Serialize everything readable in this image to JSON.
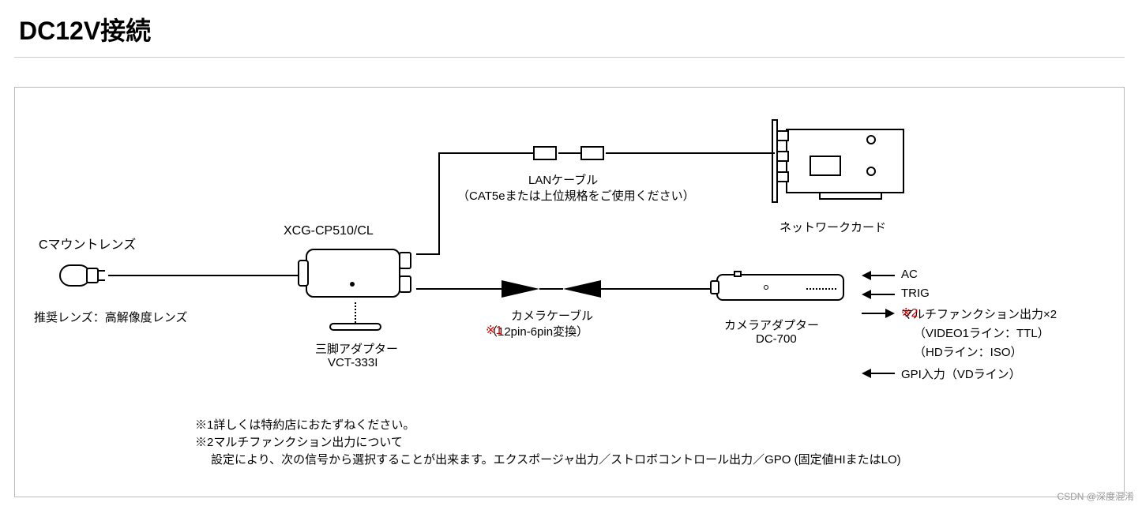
{
  "title": "DC12V接続",
  "lens": {
    "label": "Cマウントレンズ",
    "note": "推奨レンズ：高解像度レンズ"
  },
  "camera": {
    "model": "XCG-CP510/CL"
  },
  "tripod": {
    "label": "三脚アダプター",
    "model": "VCT-333I"
  },
  "lan": {
    "label": "LANケーブル",
    "note": "（CAT5eまたは上位規格をご使用ください）"
  },
  "netcard": {
    "label": "ネットワークカード"
  },
  "camcable": {
    "label": "カメラケーブル",
    "note": "（12pin-6pin変換）",
    "mark": "※1"
  },
  "adapter": {
    "label": "カメラアダプター",
    "model": "DC-700"
  },
  "io": {
    "ac": "AC",
    "trig": "TRIG",
    "multi": "マルチファンクション出力×2",
    "multimark": "※2",
    "video": "（VIDEO1ライン：TTL）",
    "hd": "（HDライン：ISO）",
    "gpi": "GPI入力（VDライン）"
  },
  "notes": {
    "n1": "※1詳しくは特約店におたずねください。",
    "n2": "※2マルチファンクション出力について",
    "n3": "設定により、次の信号から選択することが出来ます。エクスポージャ出力／ストロボコントロール出力／GPO (固定値HIまたはLO)"
  },
  "watermark": "CSDN @深度混淆"
}
